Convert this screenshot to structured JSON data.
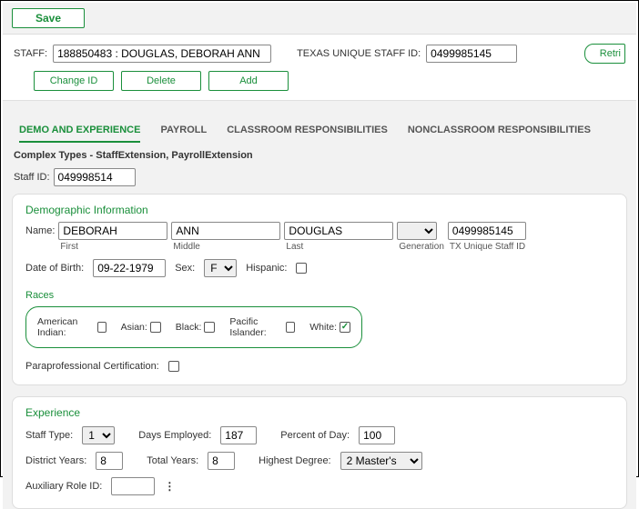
{
  "topbar": {
    "save": "Save"
  },
  "filters": {
    "staff_label": "STAFF:",
    "staff_value": "188850483 : DOUGLAS, DEBORAH ANN",
    "txuid_label": "TEXAS UNIQUE STAFF ID:",
    "txuid_value": "0499985145",
    "retrieve": "Retri"
  },
  "actions": {
    "change_id": "Change ID",
    "delete": "Delete",
    "add": "Add"
  },
  "tabs": {
    "demo": "DEMO AND EXPERIENCE",
    "payroll": "PAYROLL",
    "classroom": "CLASSROOM RESPONSIBILITIES",
    "nonclassroom": "NONCLASSROOM RESPONSIBILITIES"
  },
  "subhead": "Complex Types - StaffExtension, PayrollExtension",
  "staffid_label": "Staff ID:",
  "staffid_value": "049998514",
  "demo": {
    "title": "Demographic Information",
    "name_label": "Name:",
    "first": "DEBORAH",
    "first_lbl": "First",
    "middle": "ANN",
    "middle_lbl": "Middle",
    "last": "DOUGLAS",
    "last_lbl": "Last",
    "generation_lbl": "Generation",
    "txuid_lbl": "TX Unique Staff ID",
    "txuid_val": "0499985145",
    "dob_label": "Date of Birth:",
    "dob": "09-22-1979",
    "sex_label": "Sex:",
    "sex": "F",
    "hispanic_label": "Hispanic:",
    "races_title": "Races",
    "races": {
      "american_indian": "American Indian:",
      "asian": "Asian:",
      "black": "Black:",
      "pacific": "Pacific Islander:",
      "white": "White:"
    },
    "parapro": "Paraprofessional Certification:"
  },
  "exp": {
    "title": "Experience",
    "staff_type_lbl": "Staff Type:",
    "staff_type": "1",
    "days_lbl": "Days Employed:",
    "days": "187",
    "pct_lbl": "Percent of Day:",
    "pct": "100",
    "district_lbl": "District Years:",
    "district": "8",
    "total_lbl": "Total Years:",
    "total": "8",
    "degree_lbl": "Highest Degree:",
    "degree": "2  Master's",
    "aux_lbl": "Auxiliary Role ID:"
  }
}
